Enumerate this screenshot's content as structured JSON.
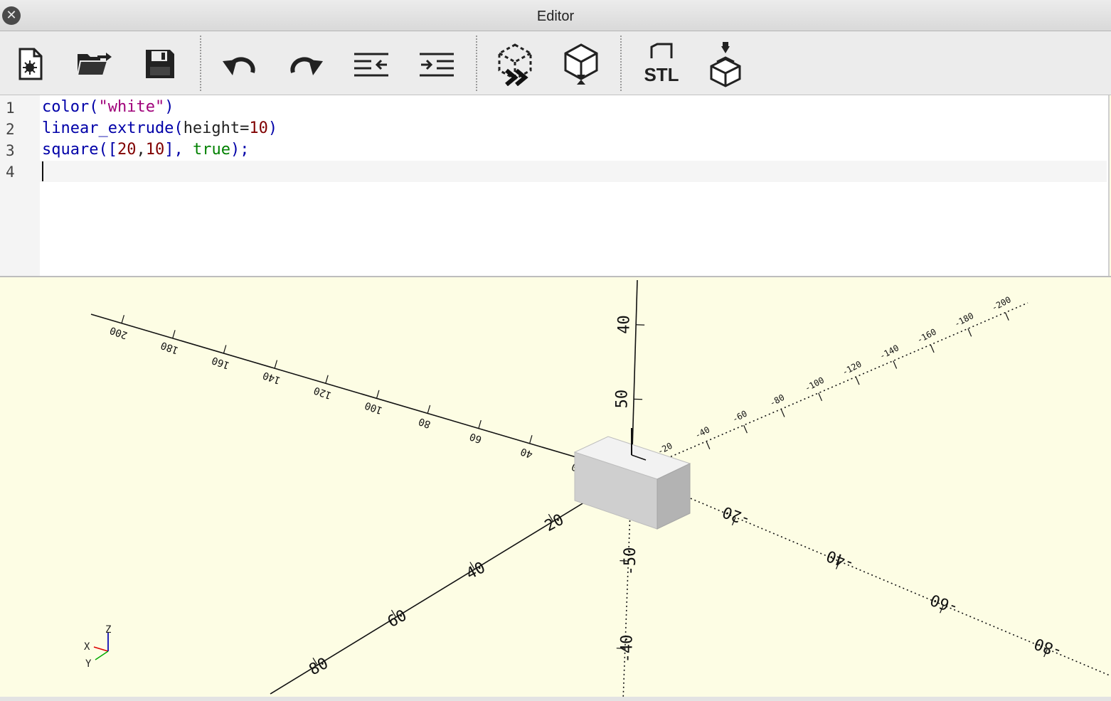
{
  "window": {
    "title": "Editor",
    "close_icon": "close-icon"
  },
  "toolbar": {
    "buttons": [
      {
        "name": "new-file-button",
        "icon": "new-file-icon"
      },
      {
        "name": "open-file-button",
        "icon": "open-folder-icon"
      },
      {
        "name": "save-button",
        "icon": "floppy-disk-icon"
      },
      {
        "name": "undo-button",
        "icon": "undo-icon"
      },
      {
        "name": "redo-button",
        "icon": "redo-icon"
      },
      {
        "name": "unindent-button",
        "icon": "unindent-icon"
      },
      {
        "name": "indent-button",
        "icon": "indent-icon"
      },
      {
        "name": "preview-button",
        "icon": "preview-render-icon"
      },
      {
        "name": "render-button",
        "icon": "render-icon"
      },
      {
        "name": "export-stl-button",
        "icon": "stl-export-icon",
        "label": "STL"
      },
      {
        "name": "send-to-print-button",
        "icon": "3d-print-icon"
      }
    ]
  },
  "editor": {
    "line_numbers": [
      "1",
      "2",
      "3",
      "4"
    ],
    "lines": [
      [
        {
          "t": "color(",
          "c": "kw"
        },
        {
          "t": "\"white\"",
          "c": "str"
        },
        {
          "t": ")",
          "c": "kw"
        }
      ],
      [
        {
          "t": "linear_extrude(",
          "c": "kw"
        },
        {
          "t": "height=",
          "c": ""
        },
        {
          "t": "10",
          "c": "num"
        },
        {
          "t": ")",
          "c": "kw"
        }
      ],
      [
        {
          "t": "square([",
          "c": "kw"
        },
        {
          "t": "20",
          "c": "num"
        },
        {
          "t": ",",
          "c": ""
        },
        {
          "t": "10",
          "c": "num"
        },
        {
          "t": "], ",
          "c": "kw"
        },
        {
          "t": "true",
          "c": "tr"
        },
        {
          "t": ");",
          "c": "kw"
        }
      ],
      []
    ]
  },
  "viewport": {
    "background": "#fdfde4",
    "axis_labels": {
      "x_pos": [
        "20",
        "40",
        "60",
        "80"
      ],
      "x_neg": [
        "-20",
        "-40",
        "-60",
        "-80"
      ],
      "y_pos": [
        "20",
        "40",
        "60",
        "80",
        "100",
        "120",
        "140",
        "160",
        "180",
        "200"
      ],
      "y_neg": [
        "-20",
        "-40",
        "-60",
        "-80",
        "-100",
        "-120",
        "-140",
        "-160",
        "-180",
        "-200"
      ],
      "z_pos": [
        "50",
        "40"
      ],
      "z_neg": [
        "-50",
        "-40"
      ]
    },
    "gizmo": {
      "x": "X",
      "y": "Y",
      "z": "Z"
    },
    "object_color": "#d9d9d9"
  }
}
